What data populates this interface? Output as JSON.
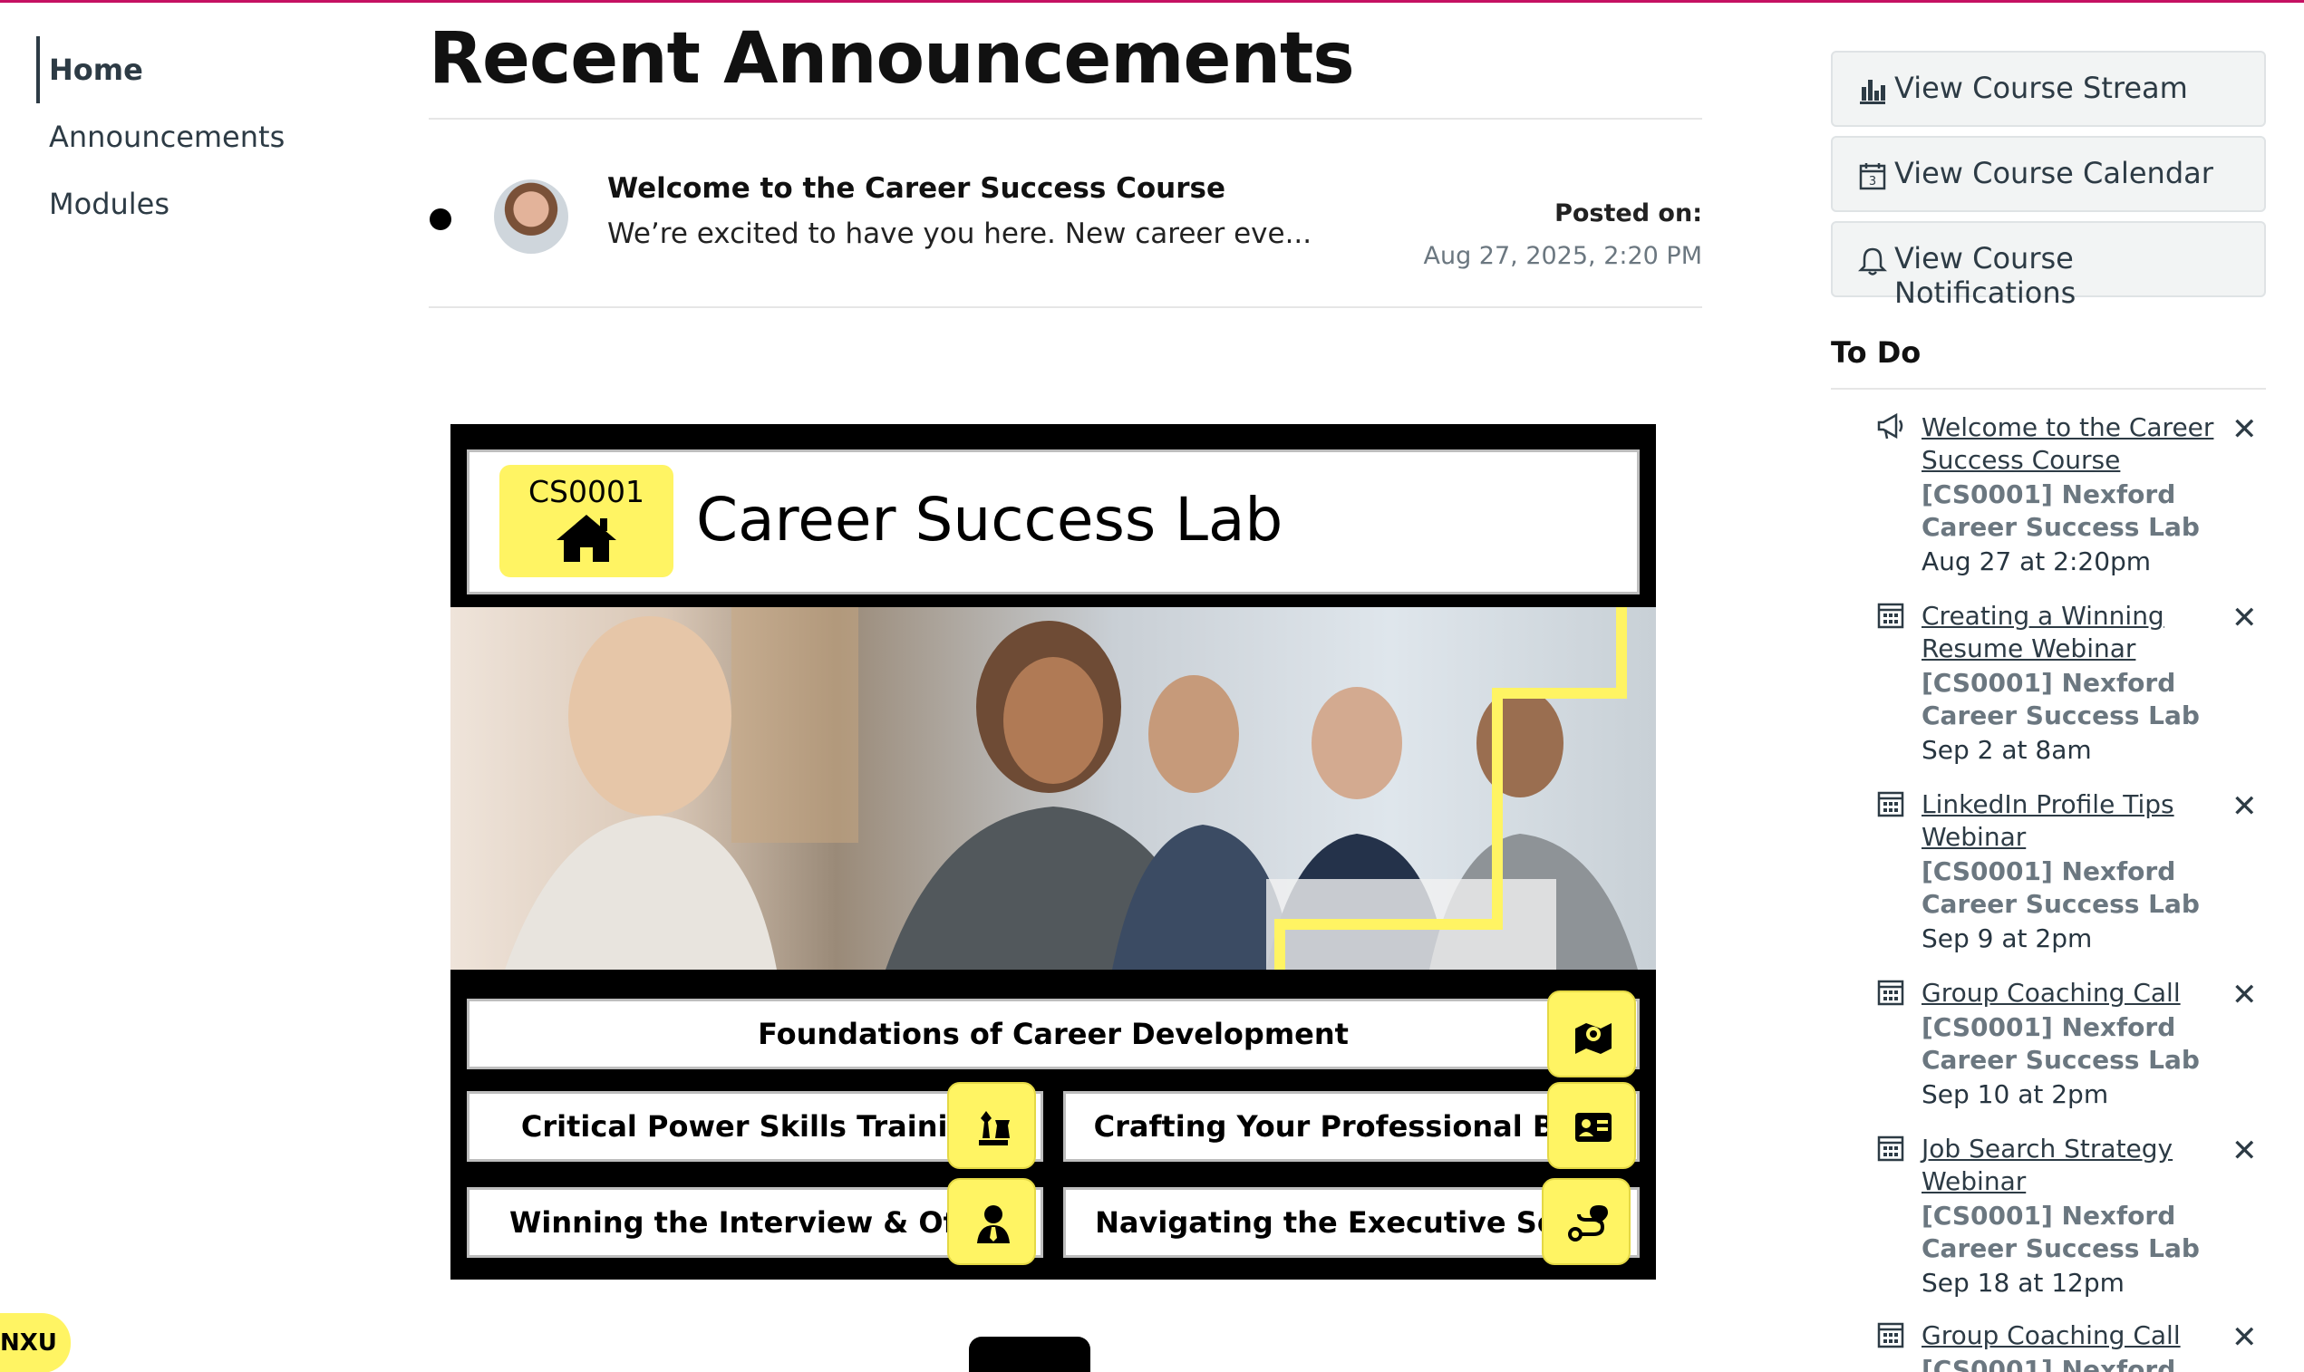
{
  "left_nav": {
    "items": [
      {
        "label": "Home",
        "active": true
      },
      {
        "label": "Announcements",
        "active": false
      },
      {
        "label": "Modules",
        "active": false
      }
    ]
  },
  "main": {
    "title": "Recent Announcements",
    "announcement": {
      "title": "Welcome to the Career Success Course",
      "excerpt": "We’re excited to have you here. New career eve...",
      "posted_label": "Posted on:",
      "posted_date": "Aug 27, 2025, 2:20 PM"
    },
    "banner": {
      "code": "CS0001",
      "title": "Career Success Lab",
      "accent_color": "#fff463",
      "tiles": [
        {
          "label": "Foundations of Career Development",
          "icon": "map-pin-icon"
        },
        {
          "label": "Critical Power Skills Training",
          "icon": "chess-pieces-icon"
        },
        {
          "label": "Crafting Your Professional Bran",
          "icon": "id-card-icon"
        },
        {
          "label": "Winning the Interview & Offer",
          "icon": "user-tie-icon"
        },
        {
          "label": "Navigating the Executive Searc",
          "icon": "route-icon"
        }
      ]
    }
  },
  "sidebar": {
    "buttons": [
      {
        "label": "View Course Stream",
        "icon": "bar-chart-icon"
      },
      {
        "label": "View Course Calendar",
        "icon": "calendar-icon"
      },
      {
        "label": "View Course Notifications",
        "icon": "bell-icon"
      }
    ],
    "todo": {
      "title": "To Do",
      "items": [
        {
          "title": "Welcome to the Career Success Course",
          "course": "[CS0001] Nexford Career Success Lab",
          "date": "Aug 27 at 2:20pm",
          "icon": "megaphone-icon"
        },
        {
          "title": "Creating a Winning Resume Webinar",
          "course": "[CS0001] Nexford Career Success Lab",
          "date": "Sep 2 at 8am",
          "icon": "calendar-event-icon"
        },
        {
          "title": "LinkedIn Profile Tips Webinar",
          "course": "[CS0001] Nexford Career Success Lab",
          "date": "Sep 9 at 2pm",
          "icon": "calendar-event-icon"
        },
        {
          "title": "Group Coaching Call",
          "course": "[CS0001] Nexford Career Success Lab",
          "date": "Sep 10 at 2pm",
          "icon": "calendar-event-icon"
        },
        {
          "title": "Job Search Strategy Webinar",
          "course": "[CS0001] Nexford Career Success Lab",
          "date": "Sep 18 at 12pm",
          "icon": "calendar-event-icon"
        },
        {
          "title": "Group Coaching Call",
          "course": "[CS0001] Nexford",
          "date": "",
          "icon": "calendar-event-icon"
        }
      ]
    }
  },
  "floating_badge": {
    "label": "NXU"
  }
}
